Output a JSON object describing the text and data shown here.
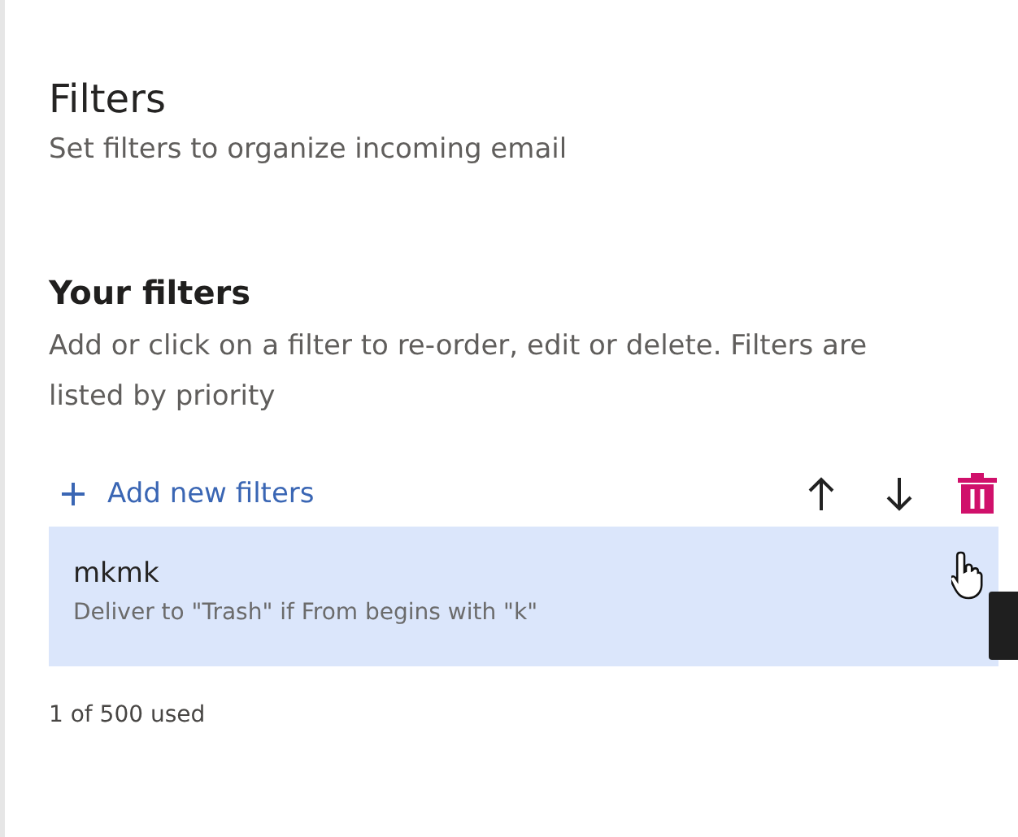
{
  "header": {
    "title": "Filters",
    "subtitle": "Set filters to organize incoming email"
  },
  "section": {
    "title": "Your filters",
    "description": "Add or click on a filter to re-order, edit or delete. Filters are listed by priority"
  },
  "toolbar": {
    "add_label": "Add new filters"
  },
  "filters": [
    {
      "name": "mkmk",
      "description": "Deliver to \"Trash\" if From begins with \"k\"",
      "selected": true
    }
  ],
  "usage": "1 of 500 used"
}
